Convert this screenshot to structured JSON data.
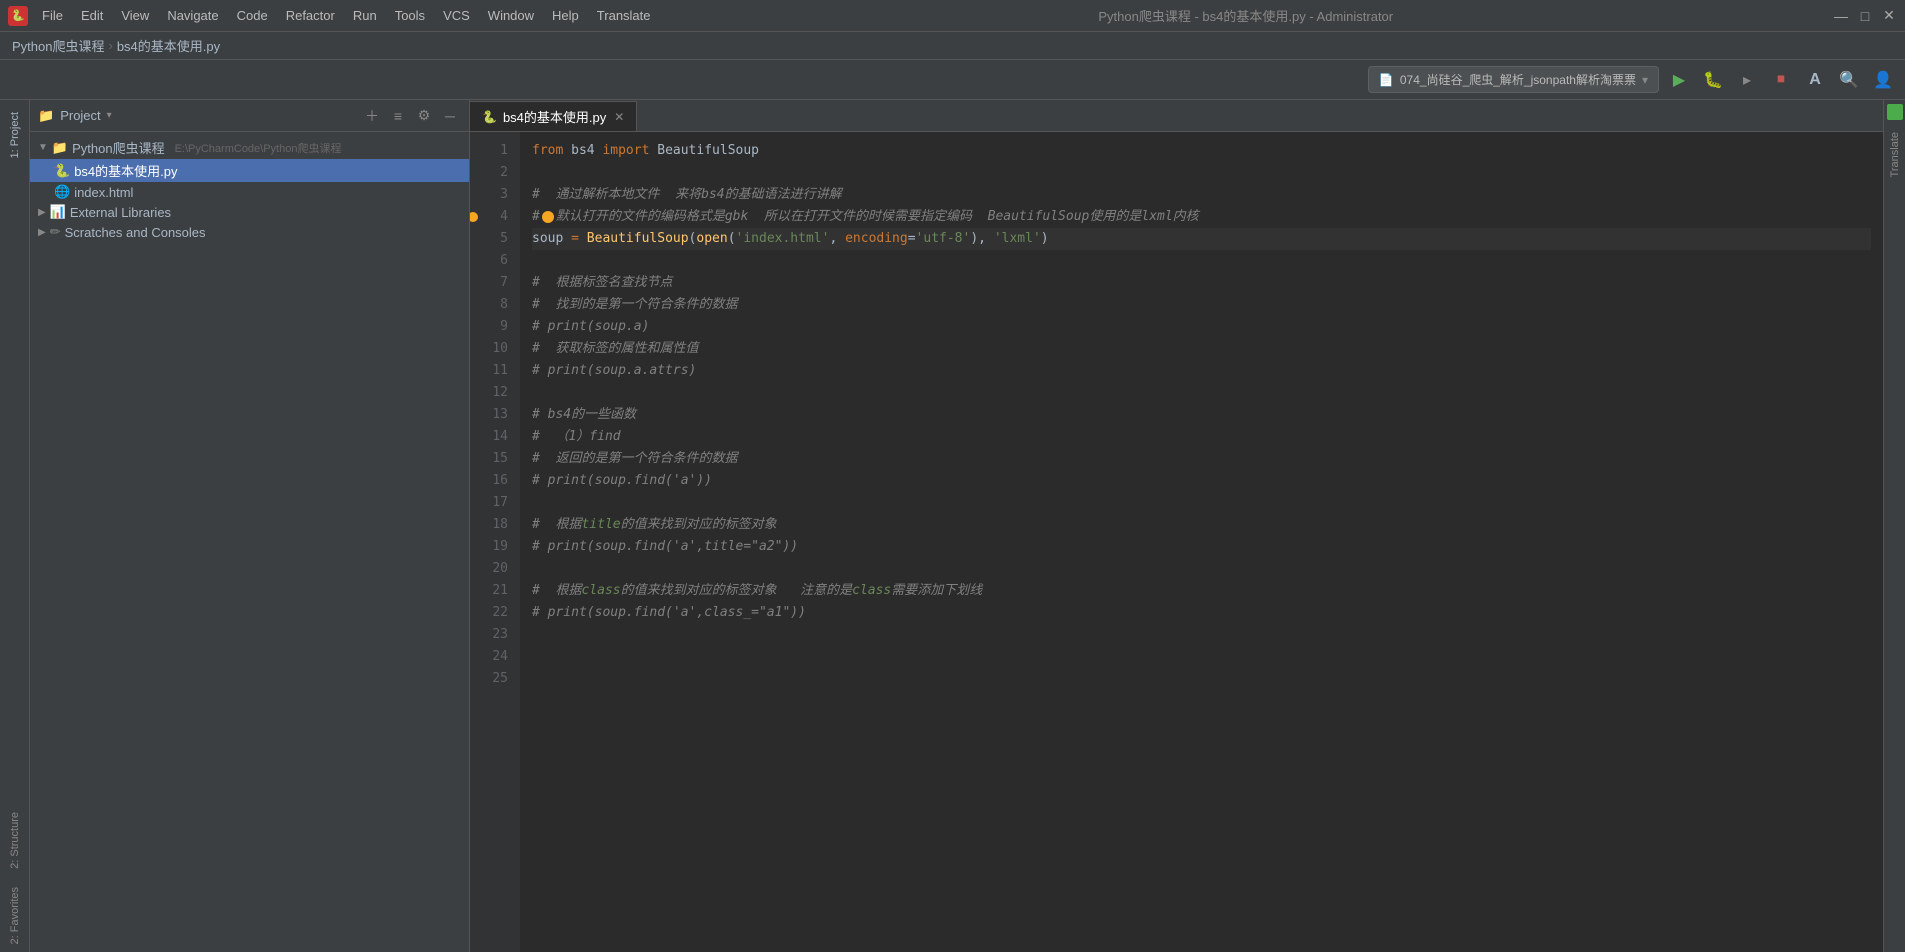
{
  "app": {
    "title": "Python爬虫课程 - bs4的基本使用.py - Administrator",
    "logo_text": "▶"
  },
  "title_bar": {
    "menus": [
      "File",
      "Edit",
      "View",
      "Navigate",
      "Code",
      "Refactor",
      "Run",
      "Tools",
      "VCS",
      "Window",
      "Help",
      "Translate"
    ],
    "minimize": "—",
    "maximize": "□",
    "close": "✕"
  },
  "breadcrumb": {
    "project": "Python爬虫课程",
    "file": "bs4的基本使用.py"
  },
  "toolbar": {
    "run_config": "074_尚硅谷_爬虫_解析_jsonpath解析淘票票",
    "run_btn": "▶",
    "debug_btn": "🐛",
    "profile_btn": "📊",
    "stop_btn": "⏹",
    "translate_btn": "A",
    "search_btn": "🔍",
    "account_btn": "👤"
  },
  "project_panel": {
    "title": "Project",
    "root": {
      "label": "Python爬虫课程",
      "path": "E:\\PyCharmCode\\Python爬虫课程"
    },
    "files": [
      {
        "name": "bs4的基本使用.py",
        "type": "py",
        "selected": true
      },
      {
        "name": "index.html",
        "type": "html"
      }
    ],
    "external_libraries": "External Libraries",
    "scratches": "Scratches and Consoles"
  },
  "editor": {
    "tab_label": "bs4的基本使用.py",
    "lines": [
      {
        "num": 1,
        "code": "from bs4 import BeautifulSoup",
        "type": "code"
      },
      {
        "num": 2,
        "code": "",
        "type": "blank"
      },
      {
        "num": 3,
        "code": "#  通过解析本地文件  来将bs4的基础语法进行讲解",
        "type": "comment"
      },
      {
        "num": 4,
        "code": "#默认打开的文件的编码格式是gbk  所以在打开文件的时候需要指定编码  BeautifulSoup使用的是lxml内核",
        "type": "comment",
        "has_breakpoint": true
      },
      {
        "num": 5,
        "code": "soup = BeautifulSoup(open('index.html', encoding='utf-8'), 'lxml')",
        "type": "code",
        "highlighted": true
      },
      {
        "num": 6,
        "code": "",
        "type": "blank"
      },
      {
        "num": 7,
        "code": "#  根据标签名查找节点",
        "type": "comment"
      },
      {
        "num": 8,
        "code": "#  找到的是第一个符合条件的数据",
        "type": "comment"
      },
      {
        "num": 9,
        "code": "# print(soup.a)",
        "type": "comment"
      },
      {
        "num": 10,
        "code": "#  获取标签的属性和属性值",
        "type": "comment"
      },
      {
        "num": 11,
        "code": "# print(soup.a.attrs)",
        "type": "comment"
      },
      {
        "num": 12,
        "code": "",
        "type": "blank"
      },
      {
        "num": 13,
        "code": "# bs4的一些函数",
        "type": "comment"
      },
      {
        "num": 14,
        "code": "#  （1）find",
        "type": "comment"
      },
      {
        "num": 15,
        "code": "#  返回的是第一个符合条件的数据",
        "type": "comment"
      },
      {
        "num": 16,
        "code": "# print(soup.find('a'))",
        "type": "comment"
      },
      {
        "num": 17,
        "code": "",
        "type": "blank"
      },
      {
        "num": 18,
        "code": "#  根据title的值来找到对应的标签对象",
        "type": "comment"
      },
      {
        "num": 19,
        "code": "# print(soup.find('a',title=\"a2\"))",
        "type": "comment"
      },
      {
        "num": 20,
        "code": "",
        "type": "blank"
      },
      {
        "num": 21,
        "code": "#  根据class的值来找到对应的标签对象   注意的是class需要添加下划线",
        "type": "comment"
      },
      {
        "num": 22,
        "code": "# print(soup.find('a',class_=\"a1\"))",
        "type": "comment"
      },
      {
        "num": 23,
        "code": "",
        "type": "blank"
      },
      {
        "num": 24,
        "code": "",
        "type": "blank"
      },
      {
        "num": 25,
        "code": "",
        "type": "blank"
      }
    ]
  },
  "side_tabs": {
    "project": "1: Project",
    "structure": "2: Structure",
    "favorites": "2: Favorites"
  },
  "right_strip": {
    "translate": "Translate"
  }
}
